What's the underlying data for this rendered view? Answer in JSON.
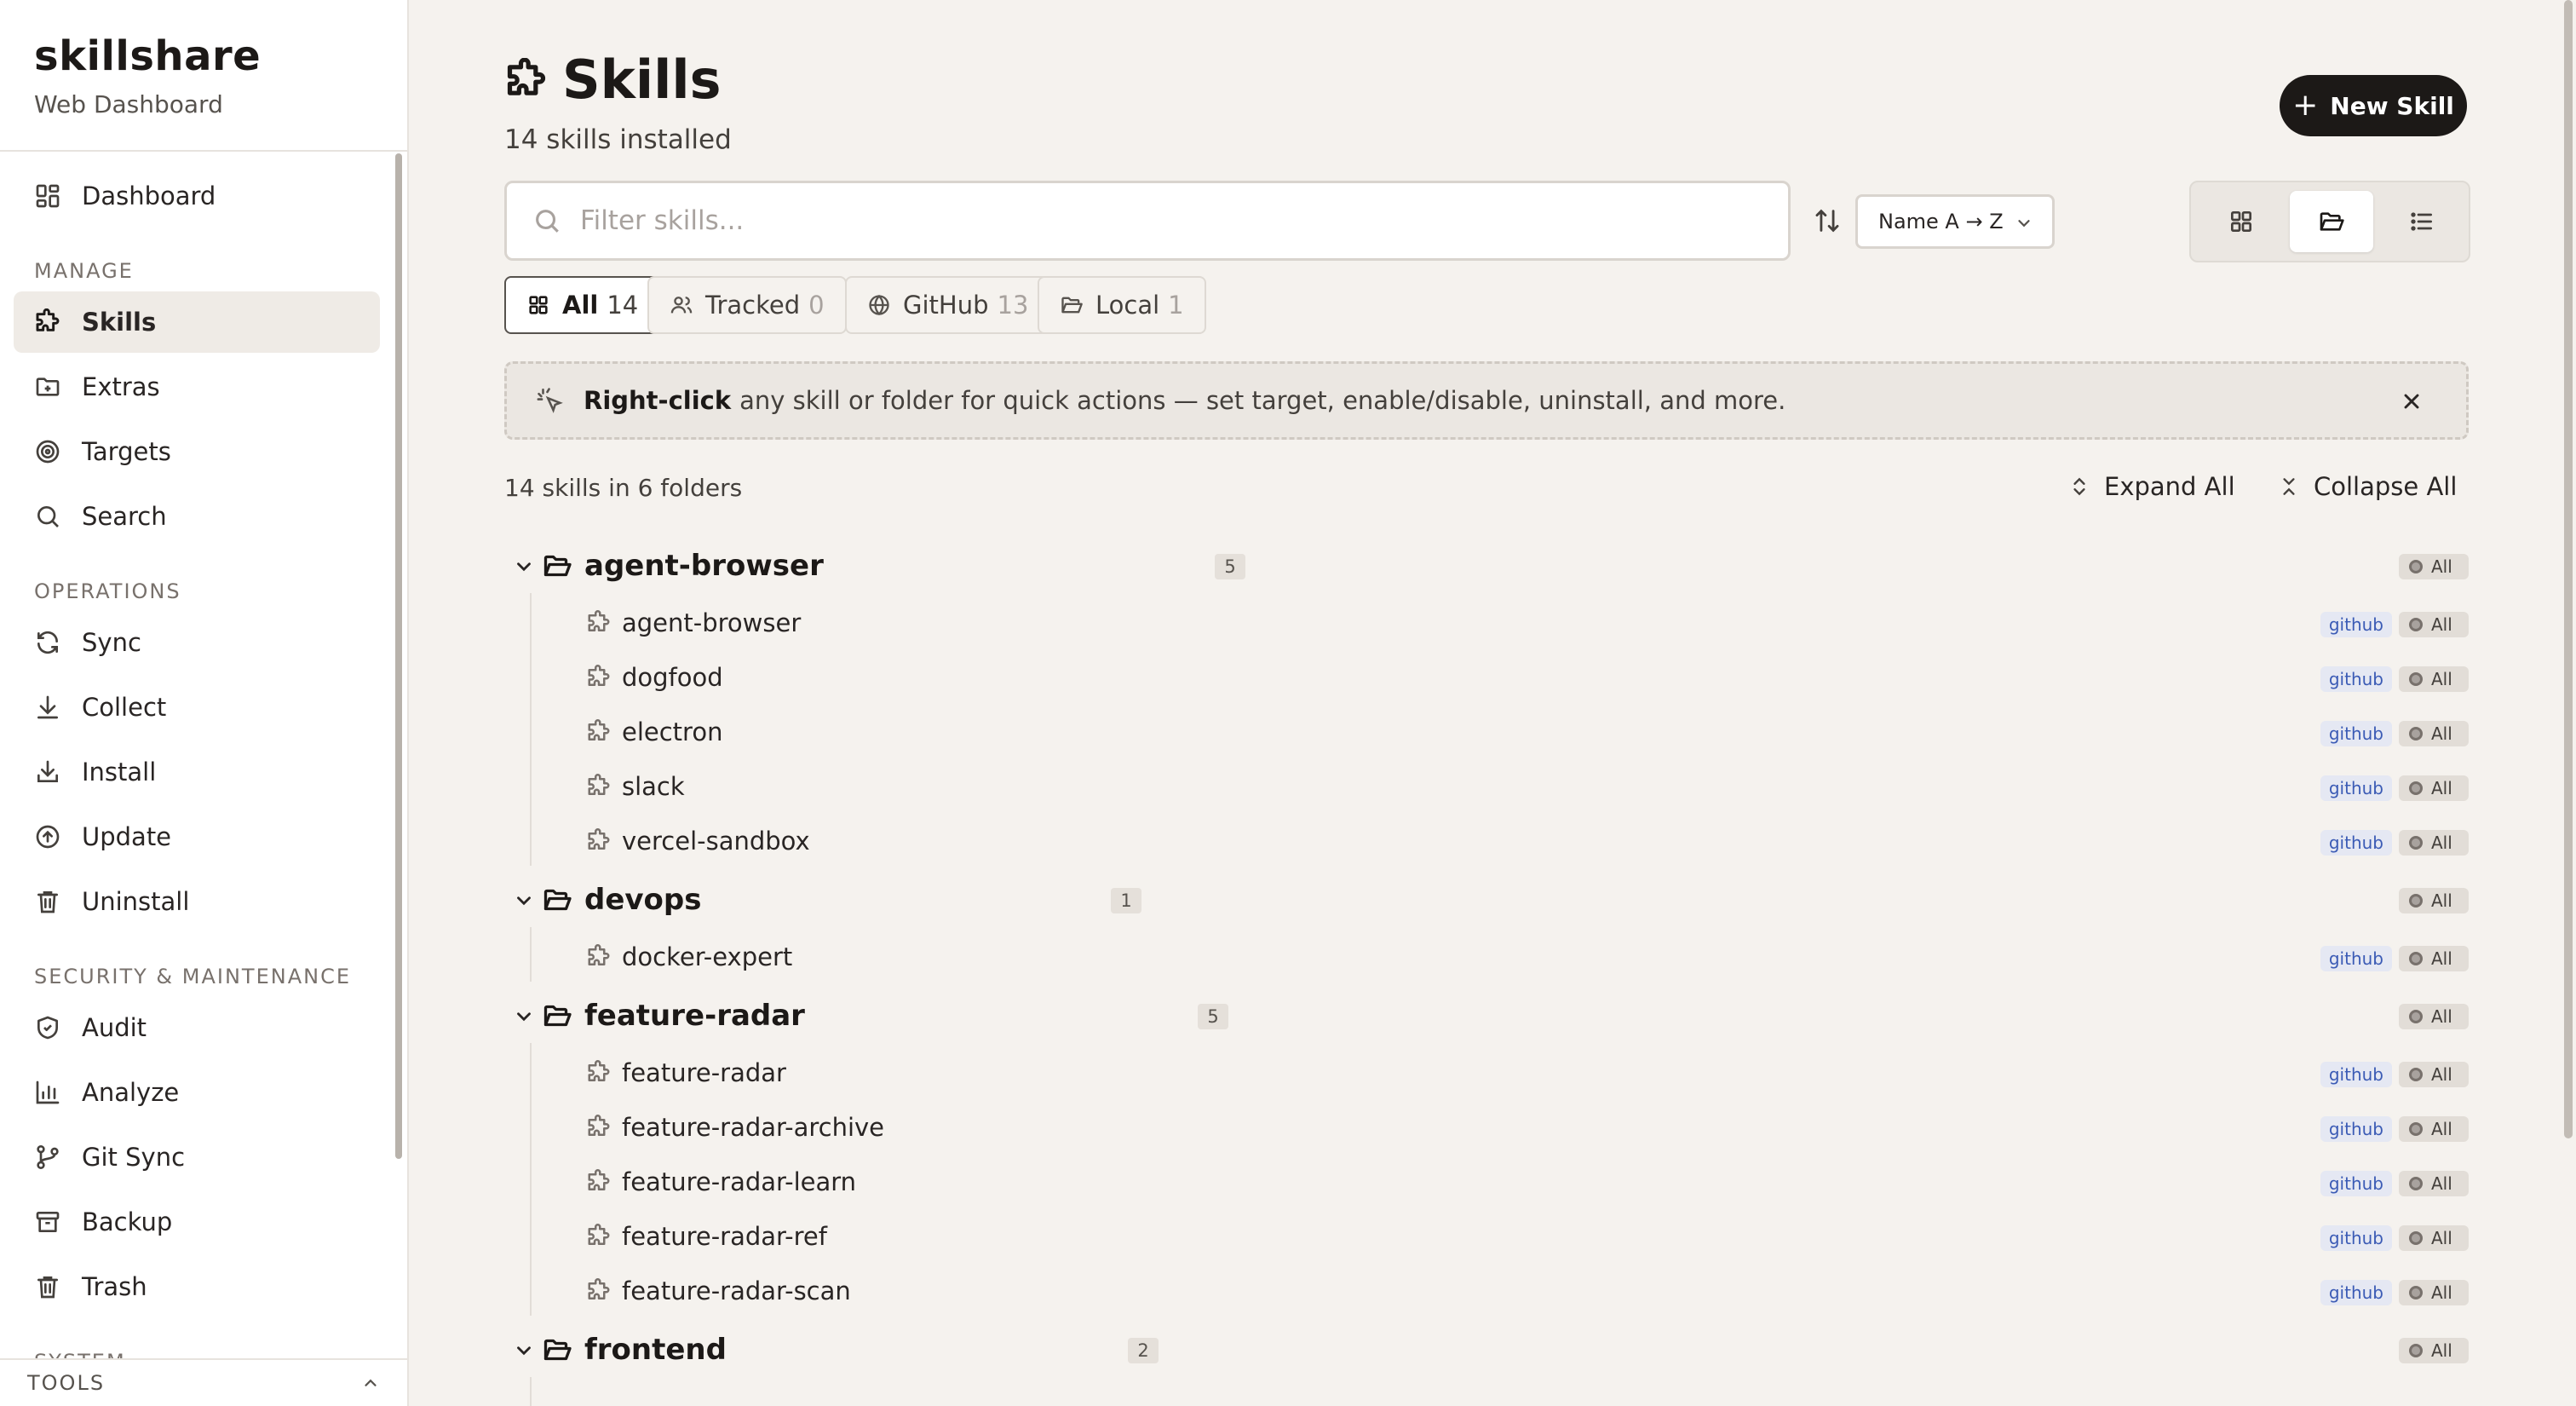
{
  "brand": {
    "title": "skillshare",
    "subtitle": "Web Dashboard"
  },
  "sidebar": {
    "dashboard": "Dashboard",
    "sections": {
      "manage": "MANAGE",
      "operations": "OPERATIONS",
      "security": "SECURITY & MAINTENANCE",
      "system": "SYSTEM"
    },
    "items": {
      "skills": "Skills",
      "extras": "Extras",
      "targets": "Targets",
      "search": "Search",
      "sync": "Sync",
      "collect": "Collect",
      "install": "Install",
      "update": "Update",
      "uninstall": "Uninstall",
      "audit": "Audit",
      "analyze": "Analyze",
      "git_sync": "Git Sync",
      "backup": "Backup",
      "trash": "Trash"
    },
    "tools_label": "TOOLS",
    "active": "Skills"
  },
  "header": {
    "title": "Skills",
    "subtitle": "14 skills installed",
    "new_button": "New Skill"
  },
  "filter": {
    "placeholder": "Filter skills...",
    "value": ""
  },
  "sort": {
    "selected": "Name A → Z"
  },
  "view_modes": {
    "options": [
      "grid",
      "folder",
      "list"
    ],
    "active": "folder"
  },
  "chips": [
    {
      "label": "All",
      "count": "14",
      "active": true
    },
    {
      "label": "Tracked",
      "count": "0",
      "active": false
    },
    {
      "label": "GitHub",
      "count": "13",
      "active": false
    },
    {
      "label": "Local",
      "count": "1",
      "active": false
    }
  ],
  "tip": {
    "bold": "Right-click",
    "text": "any skill or folder for quick actions — set target, enable/disable, uninstall, and more."
  },
  "summary": "14 skills in 6 folders",
  "actions": {
    "expand_all": "Expand All",
    "collapse_all": "Collapse All"
  },
  "tree": {
    "target_label": "All",
    "source_label": "github",
    "folders": [
      {
        "name": "agent-browser",
        "count": "5",
        "skills": [
          "agent-browser",
          "dogfood",
          "electron",
          "slack",
          "vercel-sandbox"
        ]
      },
      {
        "name": "devops",
        "count": "1",
        "skills": [
          "docker-expert"
        ]
      },
      {
        "name": "feature-radar",
        "count": "5",
        "skills": [
          "feature-radar",
          "feature-radar-archive",
          "feature-radar-learn",
          "feature-radar-ref",
          "feature-radar-scan"
        ]
      },
      {
        "name": "frontend",
        "count": "2",
        "skills": []
      }
    ]
  },
  "colors": {
    "accent": "#1c1917",
    "background": "#f5f2ee",
    "source_badge": "#3b5bb5"
  }
}
